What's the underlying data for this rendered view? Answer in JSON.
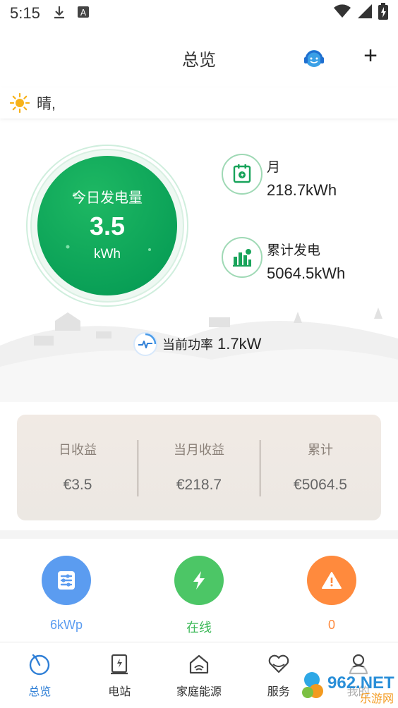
{
  "status_bar": {
    "time": "5:15",
    "icons": [
      "download-icon",
      "keyboard-a-icon",
      "wifi-icon",
      "signal-icon",
      "battery-icon"
    ],
    "keyboard_glyph": "A"
  },
  "header": {
    "title": "总览",
    "service_icon": "customer-service-icon",
    "add_icon": "plus-icon",
    "add_glyph": "+"
  },
  "weather": {
    "icon": "sun-icon",
    "text": "晴,"
  },
  "today": {
    "label": "今日发电量",
    "value": "3.5",
    "unit": "kWh"
  },
  "stats": {
    "month": {
      "label": "月",
      "value": "218.7kWh",
      "icon": "monthly-energy-icon"
    },
    "total": {
      "label": "累计发电",
      "value": "5064.5kWh",
      "icon": "bar-chart-icon"
    }
  },
  "power": {
    "label": "当前功率",
    "value": "1.7kW",
    "icon": "power-pulse-icon"
  },
  "earnings": [
    {
      "label": "日收益",
      "value": "€3.5"
    },
    {
      "label": "当月收益",
      "value": "€218.7"
    },
    {
      "label": "累计",
      "value": "€5064.5"
    }
  ],
  "quick_stats": [
    {
      "label": "6kWp",
      "icon": "capacity-icon",
      "color": "#5b9cf0",
      "text_color": "#5b9cf0"
    },
    {
      "label": "在线",
      "icon": "lightning-icon",
      "color": "#4cc666",
      "text_color": "#3fb95a"
    },
    {
      "label": "0",
      "icon": "warning-icon",
      "color": "#ff8a3d",
      "text_color": "#ff8a3d"
    }
  ],
  "tabs": [
    {
      "label": "总览",
      "icon": "overview-icon",
      "active": true
    },
    {
      "label": "电站",
      "icon": "station-icon",
      "active": false
    },
    {
      "label": "家庭能源",
      "icon": "home-energy-icon",
      "active": false
    },
    {
      "label": "服务",
      "icon": "service-heart-icon",
      "active": false
    },
    {
      "label": "我的",
      "icon": "profile-icon",
      "active": false
    }
  ],
  "watermark": {
    "brand": "962.NET",
    "sub": "乐游网"
  },
  "colors": {
    "accent_blue": "#2f7fd6",
    "gauge_green": "#0fa35a",
    "earn_label": "#8a8078"
  }
}
